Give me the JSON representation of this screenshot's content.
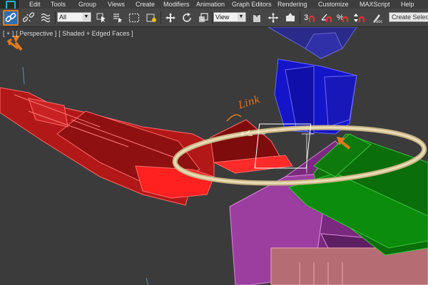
{
  "menubar": {
    "items": [
      "Edit",
      "Tools",
      "Group",
      "Views",
      "Create",
      "Modifiers",
      "Animation",
      "Graph Editors",
      "Rendering",
      "Customize",
      "MAXScript",
      "Help"
    ]
  },
  "toolbar": {
    "selection_filter": "All",
    "reference_coord": "View",
    "search_placeholder": "Create Selectio"
  },
  "viewport": {
    "label_plus": "[ + ]",
    "label_view": "[ Perspective ]",
    "label_shading": "[ Shaded + Edged Faces ]",
    "annotation": "Link",
    "gizmo_axis": "z"
  },
  "colors": {
    "accent_orange": "#e07a1f",
    "active_blue": "#2f6fb3",
    "ring": "#d9c596",
    "red_object": "#d41f1f",
    "blue_object": "#1a1ad0",
    "green_object": "#0f7a0f",
    "magenta_object": "#a44aa8"
  }
}
